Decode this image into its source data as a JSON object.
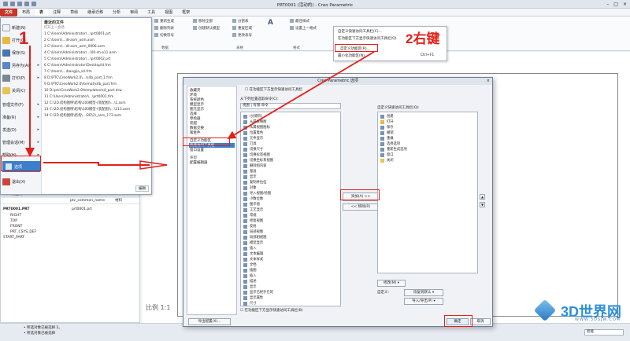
{
  "window": {
    "title": "PRT0001 (活动的) - Creo Parametric"
  },
  "ribbon_tabs": [
    "文件",
    "布局",
    "表",
    "注释",
    "草绘",
    "继承迁移",
    "分析",
    "审阅",
    "工具",
    "视图",
    "框架"
  ],
  "ribbon": {
    "buttons": [
      "重新生成",
      "删除列表",
      "切换符号",
      "移除全部",
      "创建默认模型",
      "分割表",
      "重复区域",
      "更改表号",
      "最佳样式",
      "设置上一格式",
      "Text Style",
      "编辑属性"
    ],
    "groups": [
      "数据",
      "表格",
      "行和列",
      "格式"
    ]
  },
  "file_menu": {
    "items": [
      "新建(N)",
      "打开(O)",
      "保存(S)",
      "另存为(A)",
      "打印(P)",
      "关闭(C)",
      "管理文件(F)",
      "准备(R)",
      "发送(D)",
      "管理会话(M)",
      "帮助(H)"
    ],
    "options_label": "选项",
    "exit_label": "退出(X)",
    "recent_header": "最近的文件",
    "recent_sub": "打开上一会话",
    "recent_files": [
      "1 C:\\Users\\Administrator\\...\\prt0001.prt",
      "2 C:\\Users\\...\\8-asm_asm.asm",
      "3 C:\\Users\\...\\8-asm_asm_0006.asm",
      "4 C:\\Users\\Administrator\\...\\00-sh-a11.asm",
      "5 C:\\Users\\Administrator\\...\\prt0002.prt",
      "6 C:\\Users\\Administrator\\Desktop\\d.frm",
      "7 C:\\Users\\...\\bangjia_s4.frm",
      "8 D:\\PTC\\CreoWork2.0\\...\\s4b_part_1.frm",
      "9 D:\\PTC\\CreoWork2.0\\format\\s4b_part.frm",
      "10 D:\\ptc\\CreoWork2.0\\templates\\s4_part.drw",
      "11 C:\\Users\\Administrator\\...\\prt0001.frm",
      "12 C:\\2D.结构图例\\结构\\100模型-(装配图)\\...\\1.asm",
      "13 C:\\2D.结构图例\\结构\\100模型-(装配图)\\...\\113.asm",
      "14 C:\\2D.结构图例\\结构\\...\\2D\\2\\_asm_173.asm"
    ],
    "edit_button": "编辑"
  },
  "annotations": {
    "step1": "1",
    "step2": "2右键"
  },
  "context_menu": {
    "items": [
      "自定义快速访问工具栏(C)...",
      "在功能区下方显示快速访问工具栏(Q)",
      "自定义功能区(R)...",
      "最小化功能区(N)"
    ],
    "shortcut": "Ctrl+F1"
  },
  "dialog": {
    "title": "Creo Parametric 选项",
    "close": "×",
    "categories": [
      "收藏夹",
      "环境",
      "系统颜色",
      "模型显示",
      "图元显示",
      "选择",
      "草绘器",
      "装配",
      "数据交换",
      "钣金件",
      "自定义功能区",
      "快速访问工具栏",
      "窗口设置",
      "许可",
      "配置编辑器"
    ],
    "selected_category": "快速访问工具栏",
    "checkbox_top": "在功能区下方显示快速访问工具栏",
    "from_label": "从下列位置选取命令(C):",
    "from_value": "视图 | 有限 命令",
    "commands": [
      "(分隔符)",
      "从属省略图",
      "从属视图图标",
      "位置着色",
      "元件显示",
      "刀具",
      "切换尺寸",
      "切换标签视图",
      "切换坐标系视图",
      "删除组内容",
      "基准",
      "显示",
      "复制并拉伍",
      "对象",
      "导入视图/绘图",
      "小数位数",
      "图示值",
      "工艺显示",
      "常规",
      "修复视图",
      "反射",
      "局部视图",
      "局部相视图",
      "模型显示",
      "插入",
      "文本编辑",
      "文本样式",
      "文档",
      "插图",
      "插入",
      "描述",
      "显示",
      "显示已经存在的",
      "显示属性",
      "尺寸"
    ],
    "checkbox_bottom": "在功能区下方显示快速访问工具栏(B)",
    "qat_label": "自定义快速访问工具栏(Q):",
    "qat_items": [
      "创建",
      "打开",
      "保存",
      "撤销",
      "重做",
      "选择选项",
      "重新生成选项",
      "窗口",
      "关闭"
    ],
    "add_button": "添加(A) >>",
    "remove_button": "<< 移除(R)",
    "modify_button": "修改(M) ▾",
    "customize_label": "自定义:",
    "reset_button": "恢复到默认 ▾",
    "import_button": "导入/导出(P) ▾",
    "export_config_button": "导出配置(X)...",
    "ok_button": "确定",
    "cancel_button": "取消"
  },
  "tree": {
    "header": "模型树",
    "col_name": "ptc_common_name",
    "col_mat": "材料",
    "nodes": [
      "PRT0001.PRT",
      "RIGHT",
      "TOP",
      "FRONT",
      "PRT_CSYS_DEF",
      "START_PART"
    ],
    "common_name_value": "prt0001.prt"
  },
  "canvas": {
    "scale_label": "比例 1:1"
  },
  "status": {
    "messages": [
      "• 所选对象已被选择 2。",
      "• 所选对象已被选择"
    ],
    "right_select": "智能"
  },
  "watermark": {
    "text": "3D世界网",
    "url": "WWW.3DSJW.COM"
  },
  "colors": {
    "accent": "#3b7fc9",
    "annotation": "#e0211b",
    "file_tab": "#c23b2a"
  }
}
